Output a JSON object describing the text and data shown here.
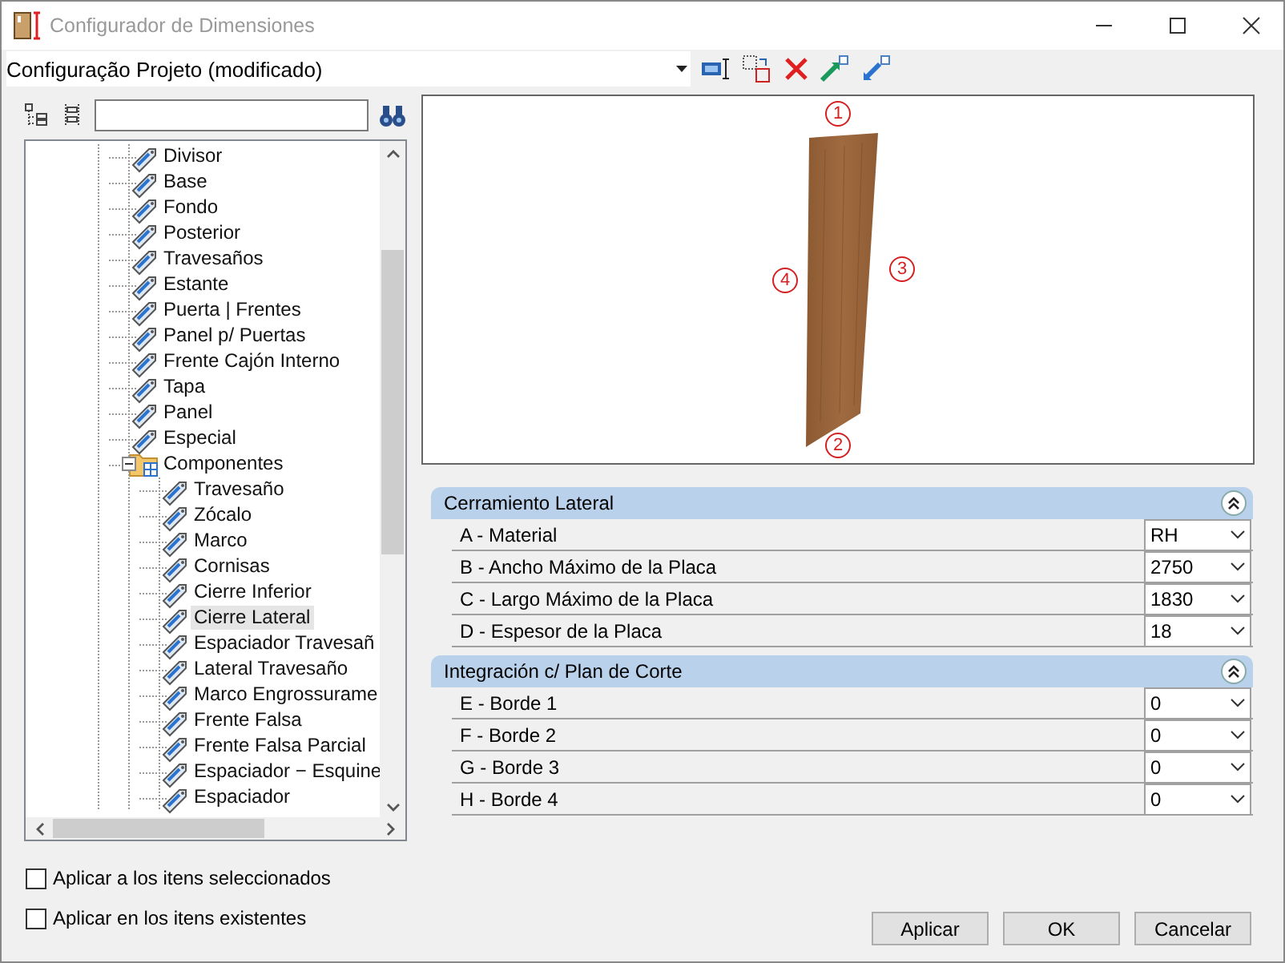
{
  "window": {
    "title": "Configurador de Dimensiones"
  },
  "config": {
    "value": "Configuração Projeto (modificado)"
  },
  "tree": {
    "items": [
      {
        "label": "Divisor",
        "kind": "item",
        "selected": false
      },
      {
        "label": "Base",
        "kind": "item",
        "selected": false
      },
      {
        "label": "Fondo",
        "kind": "item",
        "selected": false
      },
      {
        "label": "Posterior",
        "kind": "item",
        "selected": false
      },
      {
        "label": "Travesaños",
        "kind": "item",
        "selected": false
      },
      {
        "label": "Estante",
        "kind": "item",
        "selected": false
      },
      {
        "label": "Puerta | Frentes",
        "kind": "item",
        "selected": false
      },
      {
        "label": "Panel p/ Puertas",
        "kind": "item",
        "selected": false
      },
      {
        "label": "Frente Cajón Interno",
        "kind": "item",
        "selected": false
      },
      {
        "label": "Tapa",
        "kind": "item",
        "selected": false
      },
      {
        "label": "Panel",
        "kind": "item",
        "selected": false
      },
      {
        "label": "Especial",
        "kind": "item",
        "selected": false
      },
      {
        "label": "Componentes",
        "kind": "folder",
        "selected": false,
        "expanded": true,
        "children": [
          {
            "label": "Travesaño",
            "kind": "item",
            "selected": false
          },
          {
            "label": "Zócalo",
            "kind": "item",
            "selected": false
          },
          {
            "label": "Marco",
            "kind": "item",
            "selected": false
          },
          {
            "label": "Cornisas",
            "kind": "item",
            "selected": false
          },
          {
            "label": "Cierre Inferior",
            "kind": "item",
            "selected": false
          },
          {
            "label": "Cierre Lateral",
            "kind": "item",
            "selected": true
          },
          {
            "label": "Espaciador Travesañ",
            "kind": "item",
            "selected": false
          },
          {
            "label": "Lateral Travesaño",
            "kind": "item",
            "selected": false
          },
          {
            "label": "Marco Engrossurame",
            "kind": "item",
            "selected": false
          },
          {
            "label": "Frente Falsa",
            "kind": "item",
            "selected": false
          },
          {
            "label": "Frente Falsa Parcial",
            "kind": "item",
            "selected": false
          },
          {
            "label": "Espaciador − Esquine",
            "kind": "item",
            "selected": false
          },
          {
            "label": "Espaciador",
            "kind": "item",
            "selected": false
          }
        ]
      }
    ]
  },
  "preview": {
    "edges": [
      "1",
      "2",
      "3",
      "4"
    ]
  },
  "groups": [
    {
      "title": "Cerramiento Lateral",
      "expanded": true,
      "rows": [
        {
          "label": "A - Material",
          "value": "RH"
        },
        {
          "label": "B -  Ancho Máximo de la Placa",
          "value": "2750"
        },
        {
          "label": "C - Largo Máximo de la Placa",
          "value": "1830"
        },
        {
          "label": "D - Espesor de la Placa",
          "value": "18"
        }
      ]
    },
    {
      "title": "Integración c/ Plan de Corte",
      "expanded": true,
      "rows": [
        {
          "label": "E - Borde 1",
          "value": "0"
        },
        {
          "label": "F - Borde 2",
          "value": "0"
        },
        {
          "label": "G - Borde 3",
          "value": "0"
        },
        {
          "label": "H - Borde 4",
          "value": "0"
        }
      ]
    }
  ],
  "options": [
    {
      "label": "Aplicar a los itens seleccionados",
      "checked": false
    },
    {
      "label": "Aplicar en los itens existentes",
      "checked": false
    }
  ],
  "buttons": [
    "Aplicar",
    "OK",
    "Cancelar"
  ]
}
